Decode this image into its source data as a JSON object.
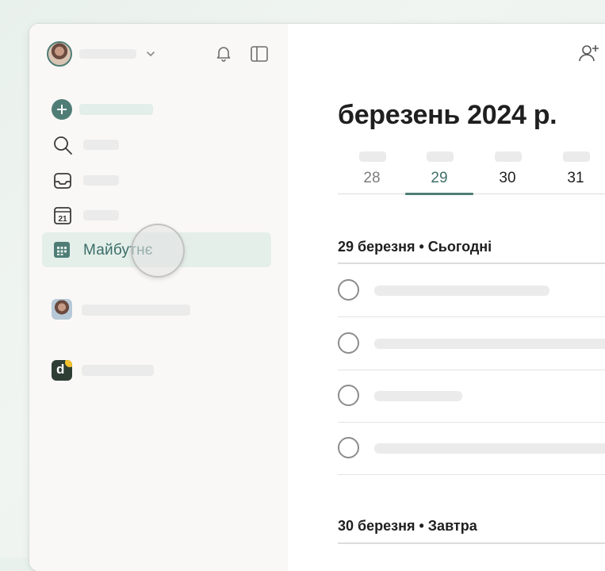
{
  "sidebar": {
    "nav": {
      "add": {
        "icon": "plus-circle-icon"
      },
      "search": {
        "icon": "search-icon"
      },
      "inbox": {
        "icon": "inbox-icon"
      },
      "today": {
        "icon": "calendar-today-icon",
        "day_number": "21"
      },
      "upcoming": {
        "icon": "calendar-grid-icon",
        "label": "Майбутнє",
        "active": true
      }
    },
    "projects": [
      {
        "icon": "user-avatar-icon"
      },
      {
        "icon": "d-app-icon",
        "letter": "d"
      }
    ]
  },
  "main": {
    "month_title": "березень 2024 р.",
    "days": [
      {
        "num": "28",
        "state": "past"
      },
      {
        "num": "29",
        "state": "selected"
      },
      {
        "num": "30",
        "state": "normal"
      },
      {
        "num": "31",
        "state": "normal"
      }
    ],
    "sections": [
      {
        "title": "29 березня • Сьогодні",
        "task_count": 4
      },
      {
        "title": "30 березня • Завтра"
      }
    ]
  },
  "colors": {
    "accent": "#4f7d76",
    "active_bg": "#e5efea",
    "sidebar_bg": "#faf8f6"
  }
}
